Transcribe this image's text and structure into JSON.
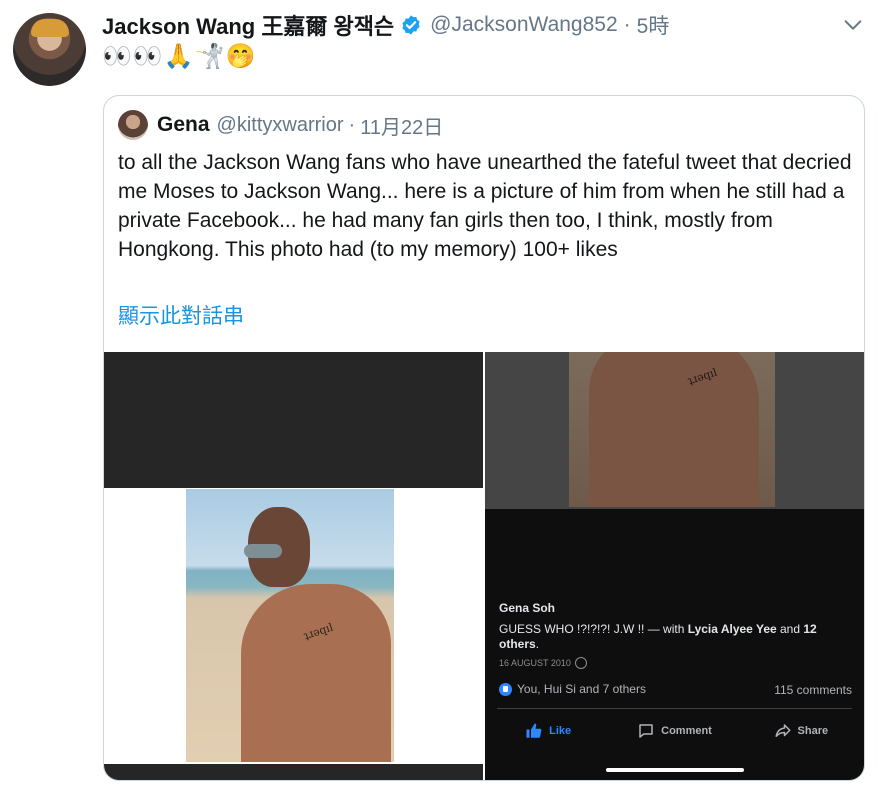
{
  "tweet": {
    "display_name": "Jackson Wang 王嘉爾 왕잭슨",
    "handle": "@JacksonWang852",
    "separator": "·",
    "time": "5時",
    "emoji_text": "👀👀🙏🤺🤭"
  },
  "quoted_tweet": {
    "name": "Gena",
    "handle": "@kittyxwarrior",
    "separator": "·",
    "date": "11月22日",
    "text": "to all the Jackson Wang fans who have unearthed the fateful tweet that decried me Moses to Jackson Wang... here is a picture of him from when he still had a private Facebook... he had many fan girls then too, I think, mostly from Hongkong. This photo had (to my memory) 100+ likes",
    "show_thread_label": "顯示此對話串"
  },
  "facebook_post": {
    "author": "Gena Soh",
    "caption_start": "GUESS WHO !?!?!?! J.W !! — with ",
    "tagged_person": "Lycia Alyee Yee",
    "caption_middle": " and ",
    "tagged_others": "12 others",
    "caption_end": ".",
    "date": "16 AUGUST 2010",
    "reactions_text": "You, Hui Si and 7 others",
    "comments_text": "115 comments",
    "actions": {
      "like": "Like",
      "comment": "Comment",
      "share": "Share"
    }
  },
  "colors": {
    "accent": "#1b95e0",
    "verified": "#1da1f2",
    "secondary_text": "#657786",
    "fb_like": "#2d88ff"
  },
  "icons": [
    "verified-badge-icon",
    "chevron-down-icon",
    "globe-icon",
    "like-reaction-icon",
    "thumbs-up-icon",
    "comment-icon",
    "share-icon"
  ]
}
